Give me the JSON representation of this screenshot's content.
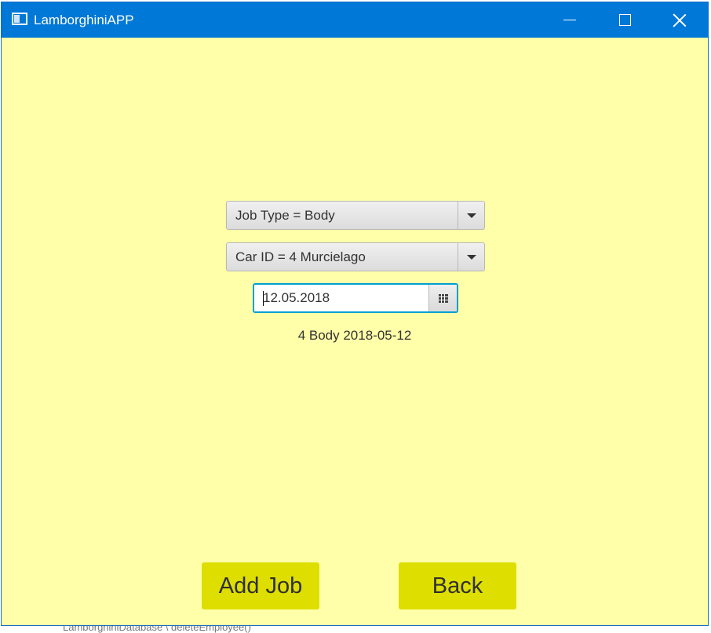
{
  "window": {
    "title": "LamborghiniAPP",
    "icon": "app-window-icon",
    "controls": {
      "minimize": "minimize-icon",
      "maximize": "maximize-icon",
      "close": "close-icon"
    }
  },
  "form": {
    "job_type": {
      "selected": "Job Type = Body"
    },
    "car_id": {
      "selected": "Car ID = 4 Murcielago"
    },
    "date": {
      "value": "12.05.2018",
      "icon": "calendar-icon"
    },
    "summary": "4 Body 2018-05-12"
  },
  "buttons": {
    "add_job": "Add Job",
    "back": "Back"
  },
  "background": {
    "behind_window_text": "LamborghiniDatabase  \\ deleteEmployee()"
  },
  "colors": {
    "titlebar": "#0078d7",
    "window_bg": "#ffffa9",
    "button_bg": "#dede00",
    "focus_border": "#039ed3"
  }
}
